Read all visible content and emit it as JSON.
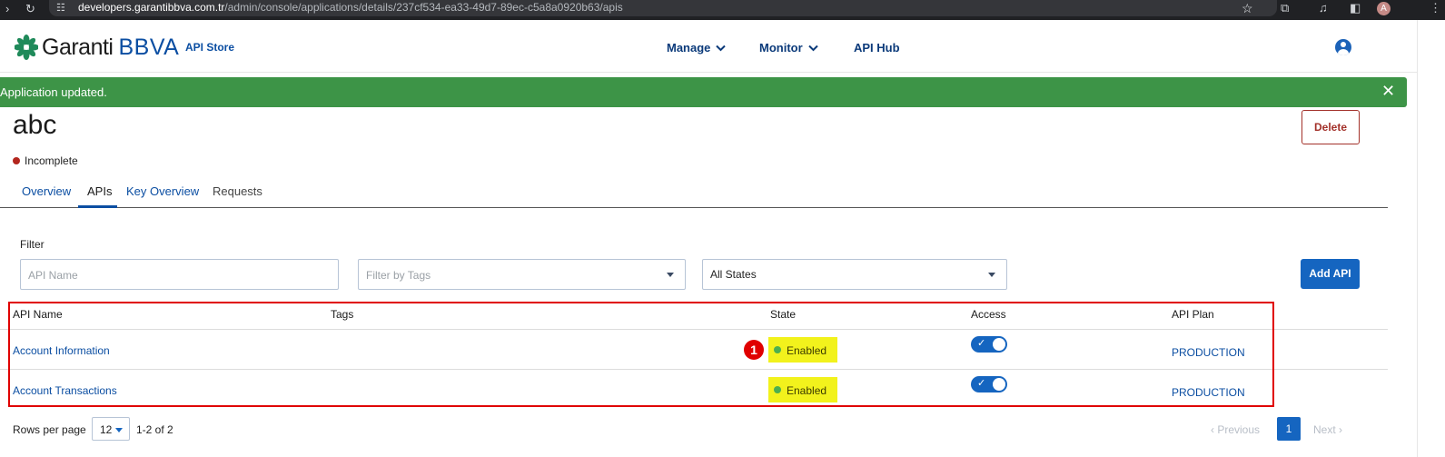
{
  "browser": {
    "url_host": "developers.garantibbva.com.tr",
    "url_path": "/admin/console/applications/details/237cf534-ea33-49d7-89ec-c5a8a0920b63/apis",
    "profile_initial": "A"
  },
  "header": {
    "brand_name": "Garanti",
    "brand_suffix": "BBVA",
    "store_label": "API Store",
    "nav": {
      "manage": "Manage",
      "monitor": "Monitor",
      "api_hub": "API Hub"
    }
  },
  "toast": {
    "message": "Application updated.",
    "close_glyph": "✕",
    "color": "#3d9447"
  },
  "application": {
    "title": "abc",
    "status": "Incomplete",
    "delete_label": "Delete"
  },
  "tabs": [
    {
      "label": "Overview"
    },
    {
      "label": "APIs"
    },
    {
      "label": "Key Overview"
    },
    {
      "label": "Requests"
    }
  ],
  "filters": {
    "label": "Filter",
    "api_name_placeholder": "API Name",
    "tags_placeholder": "Filter by Tags",
    "state_value": "All States",
    "add_api_label": "Add API"
  },
  "table": {
    "columns": [
      "API Name",
      "Tags",
      "State",
      "Access",
      "API Plan"
    ],
    "rows": [
      {
        "name": "Account Information",
        "tags": "",
        "state": "Enabled",
        "access": true,
        "plan": "PRODUCTION"
      },
      {
        "name": "Account Transactions",
        "tags": "",
        "state": "Enabled",
        "access": true,
        "plan": "PRODUCTION"
      }
    ]
  },
  "annotation": {
    "marker_number": "1",
    "highlight_color": "#e00000"
  },
  "pagination": {
    "rows_label": "Rows per page",
    "rows_value": "12",
    "range": "1-2 of 2",
    "previous": "Previous",
    "current_page": "1",
    "next": "Next"
  },
  "colors": {
    "primary": "#1565c0",
    "link": "#0b4ea2",
    "state_highlight": "#f2f21c",
    "delete": "#a3312a"
  }
}
